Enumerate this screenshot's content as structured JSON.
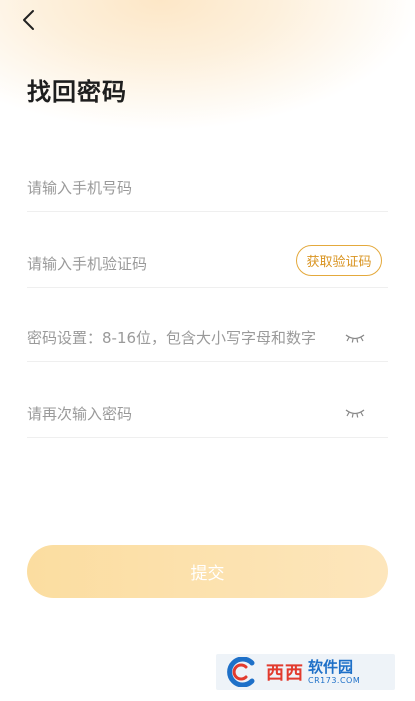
{
  "header": {
    "title": "找回密码",
    "back_icon": "back-arrow-icon"
  },
  "form": {
    "phone_placeholder": "请输入手机号码",
    "code_placeholder": "请输入手机验证码",
    "get_code_label": "获取验证码",
    "password_placeholder": "密码设置：8-16位，包含大小写字母和数字",
    "confirm_placeholder": "请再次输入密码",
    "eye_icon": "eye-closed-icon"
  },
  "submit_label": "提交",
  "watermark": {
    "main_text": "西西",
    "name_text": "软件园",
    "domain_text": "CR173.COM"
  },
  "colors": {
    "accent": "#e4a93c",
    "submit_gradient_start": "#fbdda0",
    "submit_gradient_end": "#fde6bc"
  }
}
